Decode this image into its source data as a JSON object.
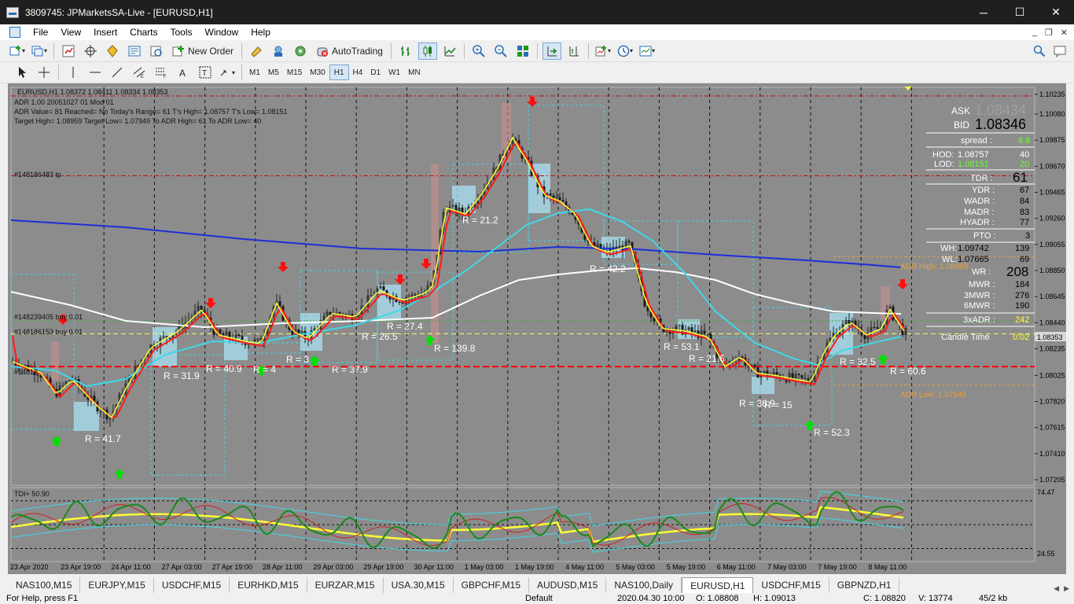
{
  "window": {
    "title": "3809745: JPMarketsSA-Live - [EURUSD,H1]",
    "minimize": "─",
    "maximize": "☐",
    "close": "✕"
  },
  "menu": [
    "File",
    "View",
    "Insert",
    "Charts",
    "Tools",
    "Window",
    "Help"
  ],
  "mdi": {
    "minimize": "_",
    "restore": "❐",
    "close": "✕"
  },
  "toolbar": {
    "new_order": "New Order",
    "autotrading": "AutoTrading",
    "timeframes": [
      "M1",
      "M5",
      "M15",
      "M30",
      "H1",
      "H4",
      "D1",
      "W1",
      "MN"
    ],
    "active_timeframe": "H1"
  },
  "chart": {
    "symbol_line": "EURUSD,H1  1.08372 1.08411 1.08334 1.08353",
    "adr_lines": [
      "ADR 1.00 20051027 01 Mod 01",
      "ADR Value= 81    Reached= No    Today's Range= 61    T's High= 1.08757    T's Low= 1.08151",
      "Target High= 1.08959    Target Low= 1.07949    To ADR High= 61    To ADR Low= 40"
    ],
    "order_labels": [
      {
        "text": "#148186483 tp",
        "price": 1.09595
      },
      {
        "text": "#148239405 buy 0.01",
        "price": 1.08455
      },
      {
        "text": "#148186153 buy 0.01",
        "price": 1.08375
      },
      {
        "text": "#14818",
        "price": 1.08095
      }
    ],
    "adr_high_label": "ADR High: 1.08959",
    "adr_low_label": "ADR Low: 1.07949",
    "current_price": "1.08353",
    "price_axis": [
      "1.10235",
      "1.10080",
      "1.09875",
      "1.09670",
      "1.09465",
      "1.09260",
      "1.09055",
      "1.08850",
      "1.08645",
      "1.08440",
      "1.08235",
      "1.08025",
      "1.07820",
      "1.07615",
      "1.07410",
      "1.07205"
    ],
    "time_axis": [
      "23 Apr 2020",
      "23 Apr 19:00",
      "24 Apr 11:00",
      "27 Apr 03:00",
      "27 Apr 19:00",
      "28 Apr 11:00",
      "29 Apr 03:00",
      "29 Apr 19:00",
      "30 Apr 11:00",
      "1 May 03:00",
      "1 May 19:00",
      "4 May 11:00",
      "5 May 03:00",
      "5 May 19:00",
      "6 May 11:00",
      "7 May 03:00",
      "7 May 19:00",
      "8 May 11:00"
    ],
    "r_labels": [
      "R = 21.2",
      "R = 139.8",
      "R = 26.5",
      "R = 27.4",
      "R = 37.9",
      "R = 31.9",
      "R = 40.9",
      "R = 41.7",
      "R = 42.2",
      "R = 53.1",
      "R = 21.6",
      "R = 36.9",
      "R = 15",
      "R = 52.3",
      "R = 32.5",
      "R = 60.6",
      "R = 4",
      "R = 3"
    ],
    "info_panel": {
      "ask_label": "ASK",
      "ask": "1.08434",
      "bid_label": "BID",
      "bid": "1.08346",
      "spread_label": "spread :",
      "spread": "8.8",
      "hod_label": "HOD:",
      "hod": "1.08757",
      "hod_pips": "40",
      "lod_label": "LOD:",
      "lod": "1.08151",
      "lod_pips": "20",
      "tdr_label": "TDR :",
      "tdr": "61",
      "ydr_label": "YDR :",
      "ydr": "67",
      "wadr_label": "WADR :",
      "wadr": "84",
      "madr_label": "MADR :",
      "madr": "83",
      "hyadr_label": "HYADR :",
      "hyadr": "77",
      "pto_label": "PTO :",
      "pto": "3",
      "wh_label": "WH:",
      "wh": "1.09742",
      "wh_pips": "139",
      "wl_label": "WL:",
      "wl": "1.07665",
      "wl_pips": "69",
      "wr_label": "WR :",
      "wr": "208",
      "mwr_label": "MWR :",
      "mwr": "184",
      "mwr3_label": "3MWR :",
      "mwr3": "276",
      "mwr6_label": "6MWR :",
      "mwr6": "190",
      "adr3x_label": "3xADR :",
      "adr3x": "242",
      "candle_time_label": "Candle Time",
      "candle_time": "0:02"
    },
    "indicator": {
      "label": "TDI+ 50.90",
      "axis_top": "74.47",
      "axis_bottom": "24.55"
    },
    "colors": {
      "background": "#8c8c8c",
      "bull": "#2e2e2e",
      "bear": "#2e2e2e",
      "ma_fast": "#ffff33",
      "ma_mid": "#ff1a1a",
      "ma_cyan": "#40d8e8",
      "ma_blue": "#1c2fd8",
      "ma_white": "#ffffff",
      "buy_arrow": "#00e000",
      "sell_arrow": "#ff1010",
      "adr_label": "#e8a040"
    }
  },
  "tabs": [
    "NAS100,M15",
    "EURJPY,M15",
    "USDCHF,M15",
    "EURHKD,M15",
    "EURZAR,M15",
    "USA.30,M15",
    "GBPCHF,M15",
    "AUDUSD,M15",
    "NAS100,Daily",
    "EURUSD,H1",
    "USDCHF,M15",
    "GBPNZD,H1"
  ],
  "active_tab": "EURUSD,H1",
  "status": {
    "help": "For Help, press F1",
    "profile": "Default",
    "datetime": "2020.04.30 10:00",
    "open": "O: 1.08808",
    "high": "H: 1.09013",
    "close": "C: 1.08820",
    "volume": "V: 13774",
    "connection": "45/2 kb"
  }
}
